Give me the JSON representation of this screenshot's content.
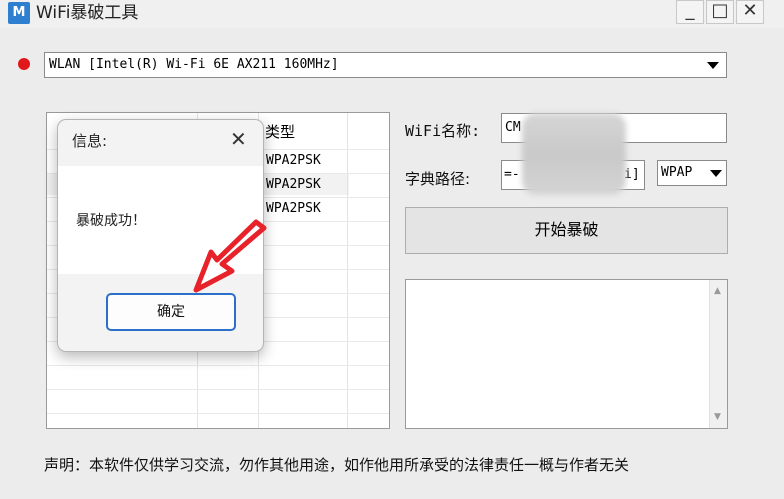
{
  "window": {
    "title": "WiFi暴破工具",
    "icon_text": "M",
    "controls": {
      "minimize": "_",
      "maximize": "□",
      "close": "✕"
    }
  },
  "adapter": {
    "selected": "WLAN [Intel(R) Wi-Fi 6E AX211 160MHz]",
    "status_color": "#e0181c"
  },
  "networks_table": {
    "columns": [
      "类型"
    ],
    "rows": [
      {
        "type": "WPA2PSK"
      },
      {
        "type": "WPA2PSK"
      },
      {
        "type": "WPA2PSK"
      }
    ]
  },
  "form": {
    "wifi_name_label": "WiFi名称:",
    "wifi_name_value": "CM",
    "dict_path_label": "字典路径:",
    "dict_path_value_left": "=-",
    "dict_path_value_right": "i]",
    "encryption_select": "WPAP",
    "start_button": "开始暴破"
  },
  "log": {
    "content": "",
    "scroll_up": "▲",
    "scroll_down": "▼"
  },
  "disclaimer": "声明：本软件仅供学习交流，勿作其他用途，如作他用所承受的法律责任一概与作者无关",
  "dialog": {
    "title": "信息:",
    "close": "✕",
    "message": "暴破成功！",
    "ok_button": "确定"
  },
  "annotation": {
    "arrow_color": "#e8222a"
  }
}
